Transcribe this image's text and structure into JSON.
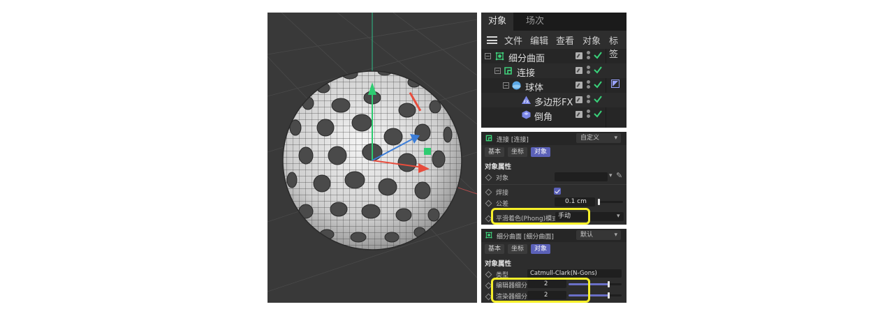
{
  "object_manager": {
    "tabs": [
      {
        "label": "对象",
        "active": true
      },
      {
        "label": "场次",
        "active": false
      }
    ],
    "menu": [
      "文件",
      "编辑",
      "查看",
      "对象",
      "标签"
    ],
    "tree": [
      {
        "label": "细分曲面",
        "icon": "subdivision-surface-icon",
        "depth": 0
      },
      {
        "label": "连接",
        "icon": "connect-icon",
        "depth": 1
      },
      {
        "label": "球体",
        "icon": "sphere-icon",
        "depth": 2
      },
      {
        "label": "多边形FX",
        "icon": "polygon-fx-icon",
        "depth": 3
      },
      {
        "label": "倒角",
        "icon": "bevel-icon",
        "depth": 3
      }
    ]
  },
  "connect_panel": {
    "title": "连接 [连接]",
    "preset": "自定义",
    "tabs": [
      "基本",
      "坐标",
      "对象"
    ],
    "active_tab": "对象",
    "section": "对象属性",
    "props": {
      "object_label": "对象",
      "object_value": "",
      "weld_label": "焊接",
      "weld_checked": true,
      "tolerance_label": "公差",
      "tolerance_value": "0.1 cm",
      "phong_label": "平滑着色(Phong)模式",
      "phong_value": "手动"
    }
  },
  "subdiv_panel": {
    "title": "细分曲面 [细分曲面]",
    "preset": "默认",
    "tabs": [
      "基本",
      "坐标",
      "对象"
    ],
    "active_tab": "对象",
    "section": "对象属性",
    "props": {
      "type_label": "类型",
      "type_value": "Catmull-Clark(N-Gons)",
      "editor_label": "编辑器细分",
      "editor_value": "2",
      "editor_fill": 0.75,
      "render_label": "渲染器细分",
      "render_value": "2",
      "render_fill": 0.75
    }
  },
  "colors": {
    "accent": "#5b61b8",
    "highlight": "#f6f02a",
    "check_green": "#39d27a"
  }
}
